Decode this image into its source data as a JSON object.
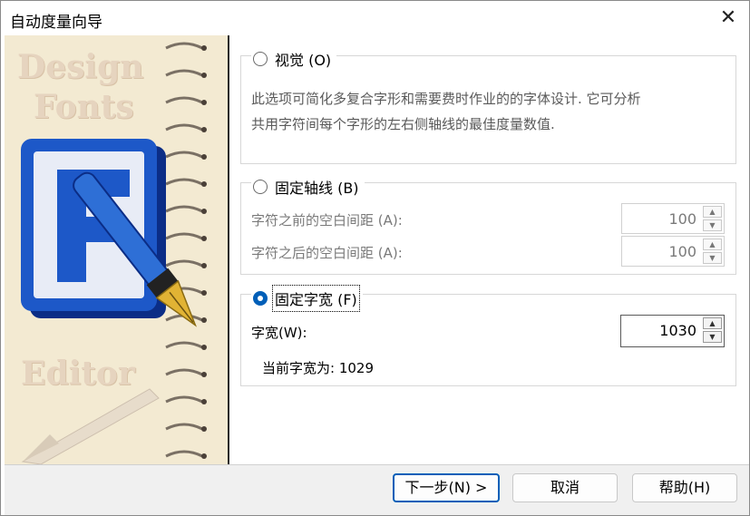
{
  "window": {
    "title": "自动度量向导",
    "close_icon": "close-icon"
  },
  "art": {
    "words": [
      "Design",
      "Fonts",
      "Editor"
    ]
  },
  "option_visual": {
    "label": "视觉 (O)",
    "description_line1": "此选项可简化多复合字形和需要费时作业的的字体设计. 它可分析",
    "description_line2": "共用字符间每个字形的左右侧轴线的最佳度量数值."
  },
  "option_fixed_axis": {
    "label": "固定轴线 (B)",
    "before_label": "字符之前的空白间距 (A):",
    "before_value": "100",
    "after_label": "字符之后的空白间距 (A):",
    "after_value": "100"
  },
  "option_fixed_width": {
    "label": "固定字宽 (F)",
    "width_label": "字宽(W):",
    "width_value": "1030",
    "current_width_text": "当前字宽为: 1029"
  },
  "footer": {
    "next_label": "下一步(N) >",
    "cancel_label": "取消",
    "help_label": "帮助(H)"
  },
  "colors": {
    "accent": "#005fb8",
    "art_background": "#f3ead2",
    "logo_blue": "#1d58c8"
  }
}
